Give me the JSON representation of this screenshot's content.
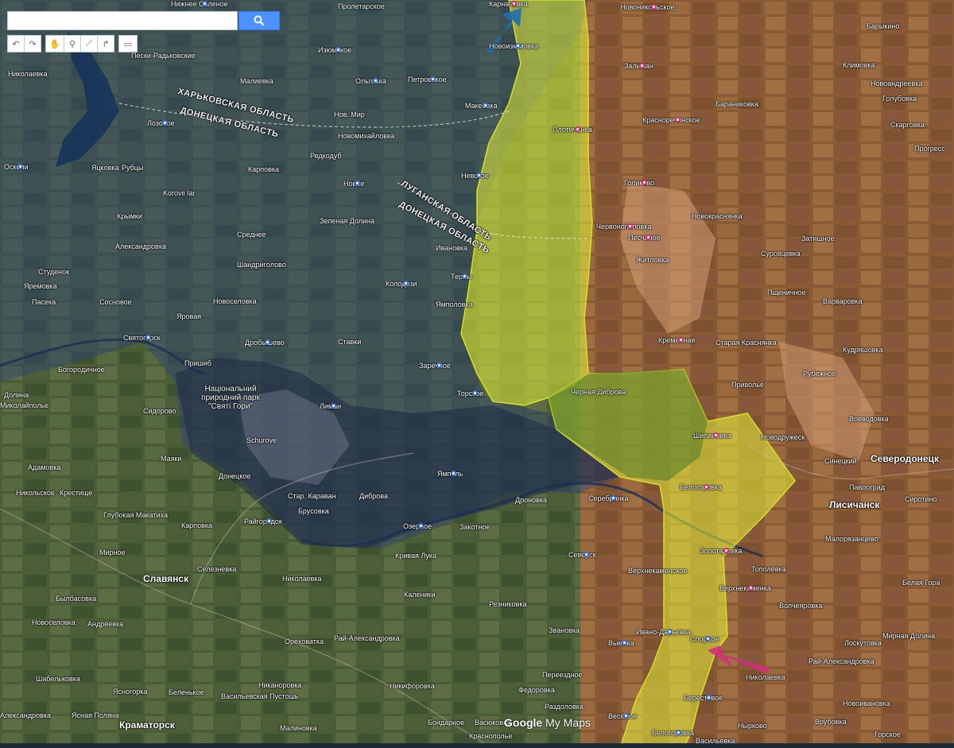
{
  "search": {
    "placeholder": "",
    "value": ""
  },
  "toolbar": {
    "undo_icon": "undo-icon",
    "redo_icon": "redo-icon",
    "hand_icon": "hand-icon",
    "marker_icon": "marker-icon",
    "line_icon": "draw-line-icon",
    "route_icon": "route-icon",
    "ruler_icon": "ruler-icon"
  },
  "watermark": {
    "google": "Google",
    "mymaps": " My Maps"
  },
  "colors": {
    "yellow_zone": "#e6f03a",
    "brown_zone": "#b8642a",
    "blue_zone": "#2c3f7a",
    "blue_arrow": "#1f6fb0",
    "pink_arrow": "#d0307a"
  },
  "regions": [
    {
      "text": "ХАРЬКОВСКАЯ ОБЛАСТЬ"
    },
    {
      "text": "ДОНЕЦКАЯ ОБЛАСТЬ"
    },
    {
      "text": "ЛУГАНСКАЯ ОБЛАСТЬ"
    },
    {
      "text": "ДОНЕЦКАЯ ОБЛАСТЬ"
    }
  ],
  "park": {
    "text": "Національний природний парк \"Святі Гори\""
  },
  "places": [
    {
      "text": "Нижнее Соленое"
    },
    {
      "text": "Пролетарское"
    },
    {
      "text": "Карначевка"
    },
    {
      "text": "Новоизюмовка"
    },
    {
      "text": "Новоникольское"
    },
    {
      "text": "Барыкино"
    },
    {
      "text": "Пески-Радьковские"
    },
    {
      "text": "Изюмское"
    },
    {
      "text": "Новоандреевка"
    },
    {
      "text": "Залиман"
    },
    {
      "text": "Климовка"
    },
    {
      "text": "Николаевка"
    },
    {
      "text": "Малиевка"
    },
    {
      "text": "Ольговка"
    },
    {
      "text": "Петровское"
    },
    {
      "text": "Голубовка"
    },
    {
      "text": "Макеевка"
    },
    {
      "text": "Бараниковка"
    },
    {
      "text": "Лозовое"
    },
    {
      "text": "Нов. Мир"
    },
    {
      "text": "Красноречинское"
    },
    {
      "text": "Скаргoвка"
    },
    {
      "text": "Плотичанка"
    },
    {
      "text": "Новомихайловка"
    },
    {
      "text": "Прогресс"
    },
    {
      "text": "Осколи"
    },
    {
      "text": "Яцковка"
    },
    {
      "text": "Рубцы"
    },
    {
      "text": "Редкодуб"
    },
    {
      "text": "Карповка"
    },
    {
      "text": "Невское"
    },
    {
      "text": "Голиково"
    },
    {
      "text": "Новое"
    },
    {
      "text": "Korovii Iar"
    },
    {
      "text": "Крымки"
    },
    {
      "text": "Зеленая Долина"
    },
    {
      "text": "Червонопоповка"
    },
    {
      "text": "Новокраснянка"
    },
    {
      "text": "Среднее"
    },
    {
      "text": "Песчаное"
    },
    {
      "text": "Затишное"
    },
    {
      "text": "Александровка"
    },
    {
      "text": "Житловка"
    },
    {
      "text": "Суровцевка"
    },
    {
      "text": "Ивановка"
    },
    {
      "text": "Шандригoлово"
    },
    {
      "text": "Студенок"
    },
    {
      "text": "Терны"
    },
    {
      "text": "Колодези"
    },
    {
      "text": "Яремовка"
    },
    {
      "text": "Новоселовка"
    },
    {
      "text": "Пасека"
    },
    {
      "text": "Сосновое"
    },
    {
      "text": "Ямполовка"
    },
    {
      "text": "Пщеничное"
    },
    {
      "text": "Варваровка"
    },
    {
      "text": "Яровая"
    },
    {
      "text": "Святогорск"
    },
    {
      "text": "Дробышево"
    },
    {
      "text": "Ставки"
    },
    {
      "text": "Кременная"
    },
    {
      "text": "Старая Краснянка"
    },
    {
      "text": "Кудряшовка"
    },
    {
      "text": "Пришиб"
    },
    {
      "text": "Богородичное"
    },
    {
      "text": "Заречное"
    },
    {
      "text": "Рубежное"
    },
    {
      "text": "Приволье"
    },
    {
      "text": "Торское"
    },
    {
      "text": "Черная Диброва"
    },
    {
      "text": "Долина"
    },
    {
      "text": "Лиман"
    },
    {
      "text": "Сидорово"
    },
    {
      "text": "Миколайполье"
    },
    {
      "text": "Воеводовка"
    },
    {
      "text": "Шипиловка"
    },
    {
      "text": "Новодружеск"
    },
    {
      "text": "Schurove"
    },
    {
      "text": "Северодонецк"
    },
    {
      "text": "Синецкий"
    },
    {
      "text": "Маяки"
    },
    {
      "text": "Адамовка"
    },
    {
      "text": "Донецкое"
    },
    {
      "text": "Ямполь"
    },
    {
      "text": "Никольское"
    },
    {
      "text": "Крестище"
    },
    {
      "text": "Белогоровка"
    },
    {
      "text": "Павлоград"
    },
    {
      "text": "Стар. Караван"
    },
    {
      "text": "Диброва"
    },
    {
      "text": "Дроновка"
    },
    {
      "text": "Серебрянка"
    },
    {
      "text": "Лисичанск"
    },
    {
      "text": "Сиротино"
    },
    {
      "text": "Глубокая Макатиха"
    },
    {
      "text": "Брусовка"
    },
    {
      "text": "Карповка"
    },
    {
      "text": "Райгородок"
    },
    {
      "text": "Озерное"
    },
    {
      "text": "Закотное"
    },
    {
      "text": "Малорязанцево"
    },
    {
      "text": "Мирное"
    },
    {
      "text": "Кривая Лука"
    },
    {
      "text": "Северск"
    },
    {
      "text": "Золотаревка"
    },
    {
      "text": "Славянск"
    },
    {
      "text": "Селезневка"
    },
    {
      "text": "Николаевка"
    },
    {
      "text": "Верхнекаменское"
    },
    {
      "text": "Тополевка"
    },
    {
      "text": "Былбасовка"
    },
    {
      "text": "Каленики"
    },
    {
      "text": "Верхнекаменка"
    },
    {
      "text": "Белая Гора"
    },
    {
      "text": "Резниковка"
    },
    {
      "text": "Волчеяровка"
    },
    {
      "text": "Новоселовка"
    },
    {
      "text": "Андреевка"
    },
    {
      "text": "Звановка"
    },
    {
      "text": "Иванo-Дарьевка"
    },
    {
      "text": "Спорное"
    },
    {
      "text": "Мирная Долина"
    },
    {
      "text": "Орехoватка"
    },
    {
      "text": "Рай-Александровка"
    },
    {
      "text": "Выемка"
    },
    {
      "text": "Лоскутовка"
    },
    {
      "text": "Рай-Александровка"
    },
    {
      "text": "Шабельковка"
    },
    {
      "text": "Переездное"
    },
    {
      "text": "Николаевка"
    },
    {
      "text": "Никaнoрoвкa"
    },
    {
      "text": "Никифоровка"
    },
    {
      "text": "Яснoгoрка"
    },
    {
      "text": "Беленькое"
    },
    {
      "text": "Федоровка"
    },
    {
      "text": "Новоивановка"
    },
    {
      "text": "Александровка"
    },
    {
      "text": "Ясная Поляна"
    },
    {
      "text": "Васильевская Пустошь"
    },
    {
      "text": "Раздоловка"
    },
    {
      "text": "Берестовое"
    },
    {
      "text": "Врубовка"
    },
    {
      "text": "Краматорск"
    },
    {
      "text": "Малиновка"
    },
    {
      "text": "Бондарное"
    },
    {
      "text": "Васюковка"
    },
    {
      "text": "Весёлое"
    },
    {
      "text": "Нырково"
    },
    {
      "text": "Горское"
    },
    {
      "text": "Краснополье"
    },
    {
      "text": "Белогоровка"
    },
    {
      "text": "Васильевка"
    }
  ]
}
